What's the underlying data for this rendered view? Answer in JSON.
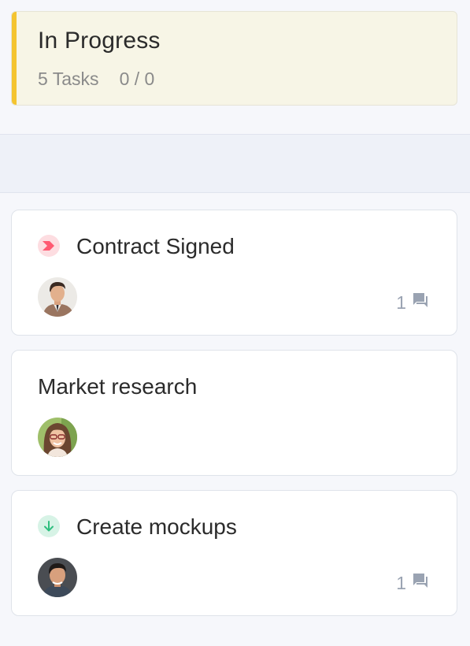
{
  "column": {
    "title": "In Progress",
    "tasks_count": "5 Tasks",
    "progress": "0 / 0",
    "accent_color": "#f4c430"
  },
  "cards": [
    {
      "title": "Contract Signed",
      "priority_icon": "high-priority-chevron-icon",
      "priority_color": "#ff5a72",
      "avatar": "avatar-man-brown-jacket",
      "comments": "1"
    },
    {
      "title": "Market research",
      "avatar": "avatar-woman-glasses"
    },
    {
      "title": "Create mockups",
      "priority_icon": "low-priority-arrow-down-icon",
      "priority_color": "#2fbf7f",
      "avatar": "avatar-man-dark-hair",
      "comments": "1"
    }
  ]
}
